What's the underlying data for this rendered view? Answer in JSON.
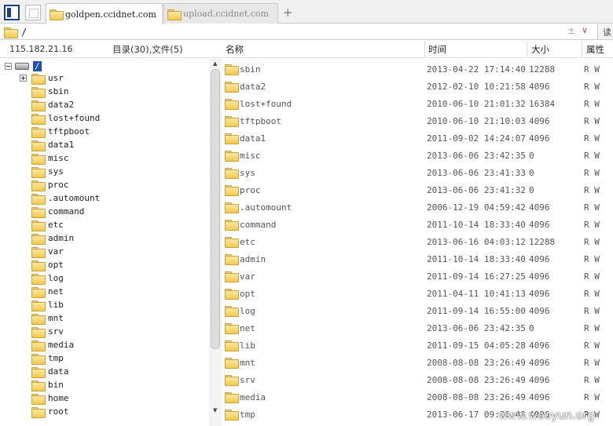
{
  "tabs": [
    {
      "label": "goldpen.ccidnet.com",
      "active": true
    },
    {
      "label": "upload.ccidnet.com",
      "active": false
    }
  ],
  "new_tab_label": "+",
  "path": {
    "value": "/",
    "plus_symbol": "±",
    "dropdown_symbol": "∨",
    "side_label": "读"
  },
  "info": {
    "ip": "115.182.21.16",
    "summary": "目录(30),文件(5)"
  },
  "columns": {
    "name": "名称",
    "time": "时间",
    "size": "大小",
    "attr": "属性"
  },
  "tree": {
    "root": "/",
    "items": [
      "usr",
      "sbin",
      "data2",
      "lost+found",
      "tftpboot",
      "data1",
      "misc",
      "sys",
      "proc",
      ".automount",
      "command",
      "etc",
      "admin",
      "var",
      "opt",
      "log",
      "net",
      "lib",
      "mnt",
      "srv",
      "media",
      "tmp",
      "data",
      "bin",
      "home",
      "root"
    ]
  },
  "scroll": {
    "up": "▲",
    "down": "▼"
  },
  "files": [
    {
      "name": "sbin",
      "time": "2013-04-22 17:14:40",
      "size": "12288",
      "attr": "R W"
    },
    {
      "name": "data2",
      "time": "2012-02-10 10:21:58",
      "size": "4096",
      "attr": "R W"
    },
    {
      "name": "lost+found",
      "time": "2010-06-10 21:01:32",
      "size": "16384",
      "attr": "R W"
    },
    {
      "name": "tftpboot",
      "time": "2010-06-10 21:10:03",
      "size": "4096",
      "attr": "R W"
    },
    {
      "name": "data1",
      "time": "2011-09-02 14:24:07",
      "size": "4096",
      "attr": "R W"
    },
    {
      "name": "misc",
      "time": "2013-06-06 23:42:35",
      "size": "0",
      "attr": "R W"
    },
    {
      "name": "sys",
      "time": "2013-06-06 23:41:33",
      "size": "0",
      "attr": "R W"
    },
    {
      "name": "proc",
      "time": "2013-06-06 23:41:32",
      "size": "0",
      "attr": "R W"
    },
    {
      "name": ".automount",
      "time": "2006-12-19 04:59:42",
      "size": "4096",
      "attr": "R W"
    },
    {
      "name": "command",
      "time": "2011-10-14 18:33:40",
      "size": "4096",
      "attr": "R W"
    },
    {
      "name": "etc",
      "time": "2013-06-16 04:03:12",
      "size": "12288",
      "attr": "R W"
    },
    {
      "name": "admin",
      "time": "2011-10-14 18:33:40",
      "size": "4096",
      "attr": "R W"
    },
    {
      "name": "var",
      "time": "2011-09-14 16:27:25",
      "size": "4096",
      "attr": "R W"
    },
    {
      "name": "opt",
      "time": "2011-04-11 10:41:13",
      "size": "4096",
      "attr": "R W"
    },
    {
      "name": "log",
      "time": "2011-09-14 16:55:00",
      "size": "4096",
      "attr": "R W"
    },
    {
      "name": "net",
      "time": "2013-06-06 23:42:35",
      "size": "0",
      "attr": "R W"
    },
    {
      "name": "lib",
      "time": "2011-09-15 04:05:28",
      "size": "4096",
      "attr": "R W"
    },
    {
      "name": "mnt",
      "time": "2008-08-08 23:26:49",
      "size": "4096",
      "attr": "R W"
    },
    {
      "name": "srv",
      "time": "2008-08-08 23:26:49",
      "size": "4096",
      "attr": "R W"
    },
    {
      "name": "media",
      "time": "2008-08-08 23:26:49",
      "size": "4096",
      "attr": "R W"
    },
    {
      "name": "tmp",
      "time": "2013-06-17 09:36:40",
      "size": "4096",
      "attr": "R W"
    }
  ],
  "watermark": "www.wooyun.org"
}
